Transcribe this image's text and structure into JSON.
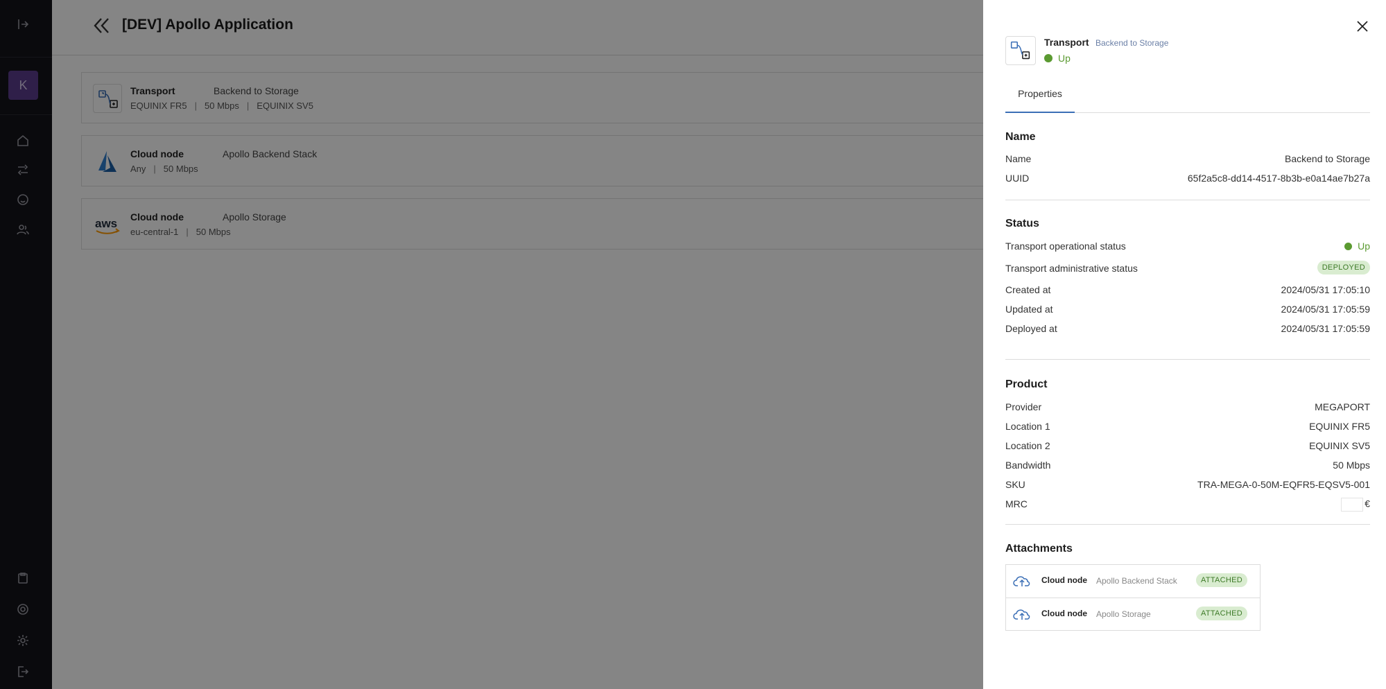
{
  "rail": {
    "avatar_letter": "K",
    "icons": [
      "collapse-icon",
      "home-icon",
      "connections-icon",
      "support-icon",
      "users-icon",
      "clipboard-icon",
      "help-icon",
      "settings-icon",
      "logout-icon"
    ]
  },
  "header": {
    "title": "[DEV] Apollo Application"
  },
  "cards": [
    {
      "type": "Transport",
      "name": "Backend to Storage",
      "meta": [
        "EQUINIX FR5",
        "50 Mbps",
        "EQUINIX SV5"
      ],
      "icon": "transport-icon"
    },
    {
      "type": "Cloud node",
      "name": "Apollo Backend Stack",
      "meta": [
        "Any",
        "50 Mbps"
      ],
      "icon": "azure-logo-icon"
    },
    {
      "type": "Cloud node",
      "name": "Apollo Storage",
      "meta": [
        "eu-central-1",
        "50 Mbps"
      ],
      "icon": "aws-logo-icon"
    }
  ],
  "drawer": {
    "type": "Transport",
    "name": "Backend to Storage",
    "status": "Up",
    "tab": "Properties",
    "name_section": {
      "title": "Name",
      "rows": [
        {
          "label": "Name",
          "value": "Backend to Storage"
        },
        {
          "label": "UUID",
          "value": "65f2a5c8-dd14-4517-8b3b-e0a14ae7b27a"
        }
      ]
    },
    "status_section": {
      "title": "Status",
      "operational_label": "Transport operational status",
      "operational_value": "Up",
      "administrative_label": "Transport administrative status",
      "administrative_value": "DEPLOYED",
      "rows": [
        {
          "label": "Created at",
          "value": "2024/05/31 17:05:10"
        },
        {
          "label": "Updated at",
          "value": "2024/05/31 17:05:59"
        },
        {
          "label": "Deployed at",
          "value": "2024/05/31 17:05:59"
        }
      ]
    },
    "product_section": {
      "title": "Product",
      "rows": [
        {
          "label": "Provider",
          "value": "MEGAPORT"
        },
        {
          "label": "Location 1",
          "value": "EQUINIX FR5"
        },
        {
          "label": "Location 2",
          "value": "EQUINIX SV5"
        },
        {
          "label": "Bandwidth",
          "value": "50 Mbps"
        },
        {
          "label": "SKU",
          "value": "TRA-MEGA-0-50M-EQFR5-EQSV5-001"
        }
      ],
      "mrc_label": "MRC",
      "mrc_currency": "€"
    },
    "attachments_section": {
      "title": "Attachments",
      "items": [
        {
          "type": "Cloud node",
          "name": "Apollo Backend Stack",
          "status": "ATTACHED"
        },
        {
          "type": "Cloud node",
          "name": "Apollo Storage",
          "status": "ATTACHED"
        }
      ]
    }
  },
  "colors": {
    "accent": "#3b6fb6",
    "success": "#5b9a31",
    "rail_bg": "#15151a",
    "avatar_bg": "#5b3c8c"
  }
}
